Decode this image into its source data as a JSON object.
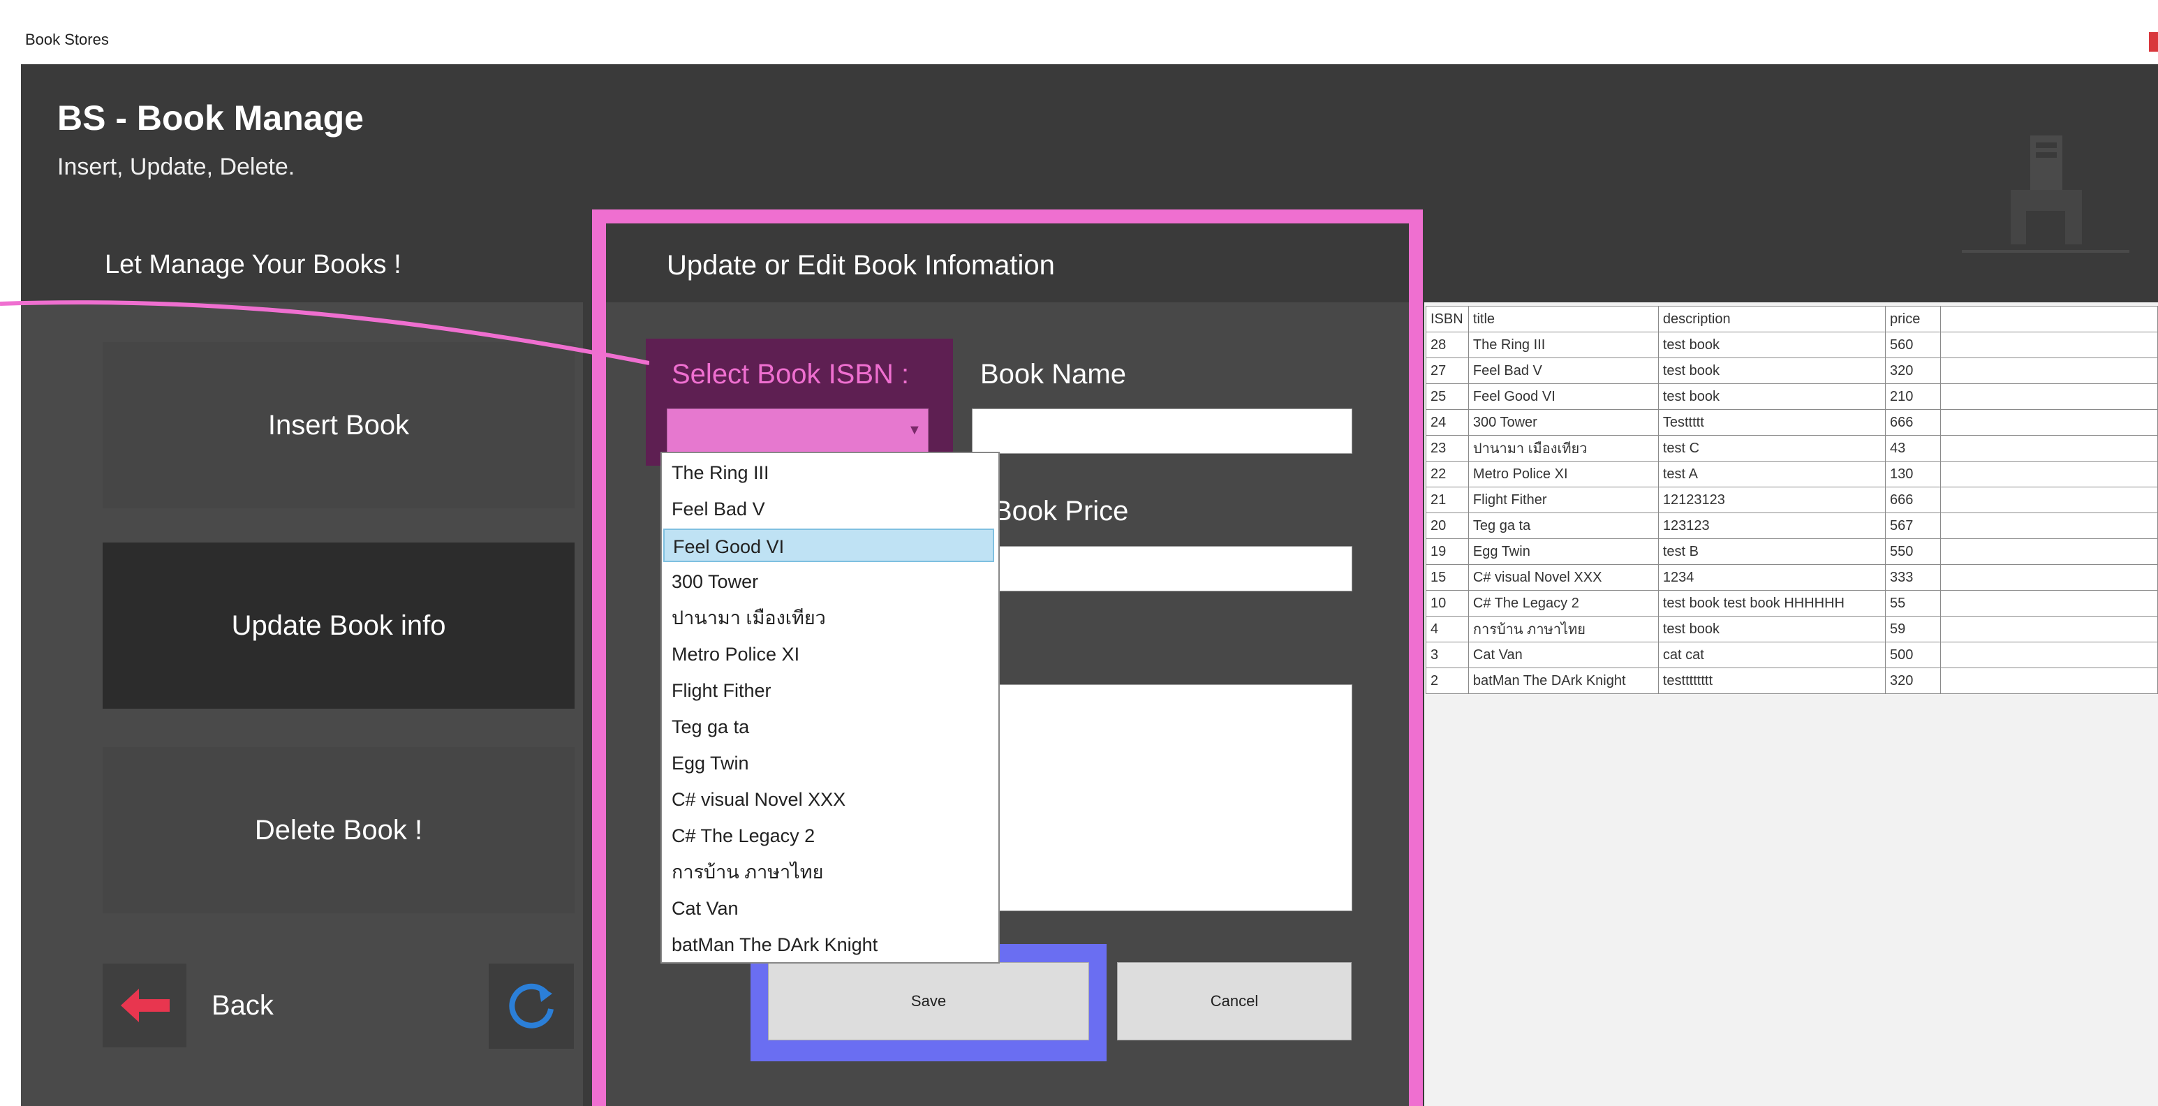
{
  "window": {
    "title": "Book Stores",
    "close_color": "#d9373c"
  },
  "header": {
    "title": "BS - Book Manage",
    "subtitle": "Insert, Update, Delete."
  },
  "left_panel": {
    "title": "Let Manage Your Books !",
    "buttons": {
      "insert": "Insert Book",
      "update": "Update Book info",
      "delete": "Delete Book !",
      "back": "Back"
    },
    "icons": {
      "back": "back-arrow-icon",
      "refresh": "refresh-icon"
    }
  },
  "center_panel": {
    "title": "Update or Edit Book Infomation",
    "isbn_label": "Select Book ISBN :",
    "book_name_label": "Book Name",
    "book_price_label": "Book Price",
    "book_name_value": "",
    "book_price_value": "",
    "description_value": "",
    "save_label": "Save",
    "cancel_label": "Cancel",
    "highlight_color": "#ef6fd0",
    "save_highlight_color": "#6a6ef2"
  },
  "dropdown": {
    "selected_index": 2,
    "items": [
      "The Ring III",
      "Feel Bad V",
      "Feel Good VI",
      "300 Tower",
      "ปานามา เมืองเทียว",
      "Metro Police XI",
      "Flight Fither",
      "Teg ga ta",
      "Egg Twin",
      "C# visual Novel XXX",
      "C# The Legacy 2",
      "การบ้าน ภาษาไทย",
      "Cat Van",
      "batMan The DArk Knight"
    ]
  },
  "table": {
    "columns": [
      "ISBN",
      "title",
      "description",
      "price"
    ],
    "rows": [
      [
        "28",
        "The Ring III",
        "test book",
        "560"
      ],
      [
        "27",
        "Feel Bad V",
        "test book",
        "320"
      ],
      [
        "25",
        "Feel Good VI",
        "test book",
        "210"
      ],
      [
        "24",
        "300 Tower",
        "Testtttt",
        "666"
      ],
      [
        "23",
        "ปานามา เมืองเทียว",
        "test C",
        "43"
      ],
      [
        "22",
        "Metro Police XI",
        "test A",
        "130"
      ],
      [
        "21",
        "Flight Fither",
        "12123123",
        "666"
      ],
      [
        "20",
        "Teg ga ta",
        "123123",
        "567"
      ],
      [
        "19",
        "Egg Twin",
        "test B",
        "550"
      ],
      [
        "15",
        "C# visual Novel XXX",
        "1234",
        "333"
      ],
      [
        "10",
        "C# The Legacy 2",
        "test book test book HHHHHH",
        "55"
      ],
      [
        "4",
        "การบ้าน ภาษาไทย",
        "test book",
        "59"
      ],
      [
        "3",
        "Cat Van",
        "cat cat",
        "500"
      ],
      [
        "2",
        "batMan The DArk Knight",
        "testttttttt",
        "320"
      ]
    ]
  }
}
